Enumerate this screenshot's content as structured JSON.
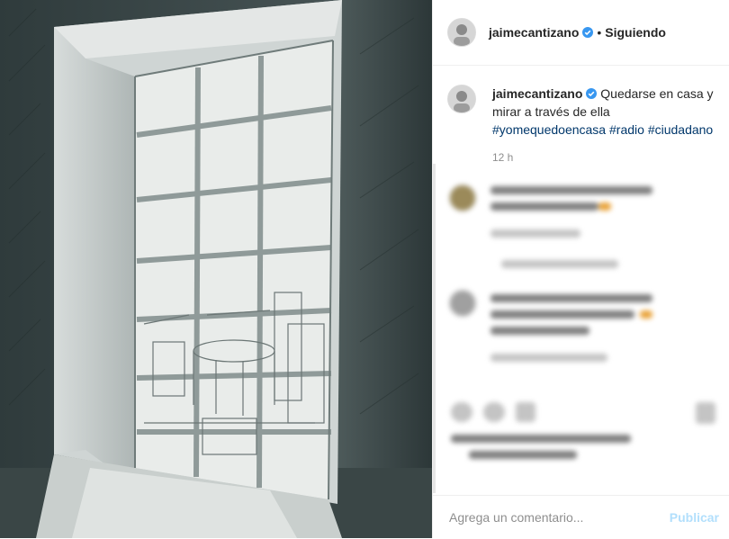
{
  "post": {
    "author": "jaimecantizano",
    "follow_status": "Siguiendo",
    "separator": "•",
    "verified_icon": "verified-badge-icon",
    "caption_text": "Quedarse en casa y mirar a través de ella",
    "hashtags": [
      "#yomequedoencasa",
      "#radio",
      "#ciudadano"
    ],
    "time_ago": "12 h"
  },
  "composer": {
    "placeholder": "Agrega un comentario...",
    "publish_label": "Publicar"
  },
  "colors": {
    "accent": "#3897f0",
    "hashtag": "#00376b",
    "publish_disabled": "#b2dffc",
    "muted": "#8e8e8e"
  },
  "icons": [
    "like-icon",
    "comment-icon",
    "share-icon",
    "save-icon"
  ]
}
